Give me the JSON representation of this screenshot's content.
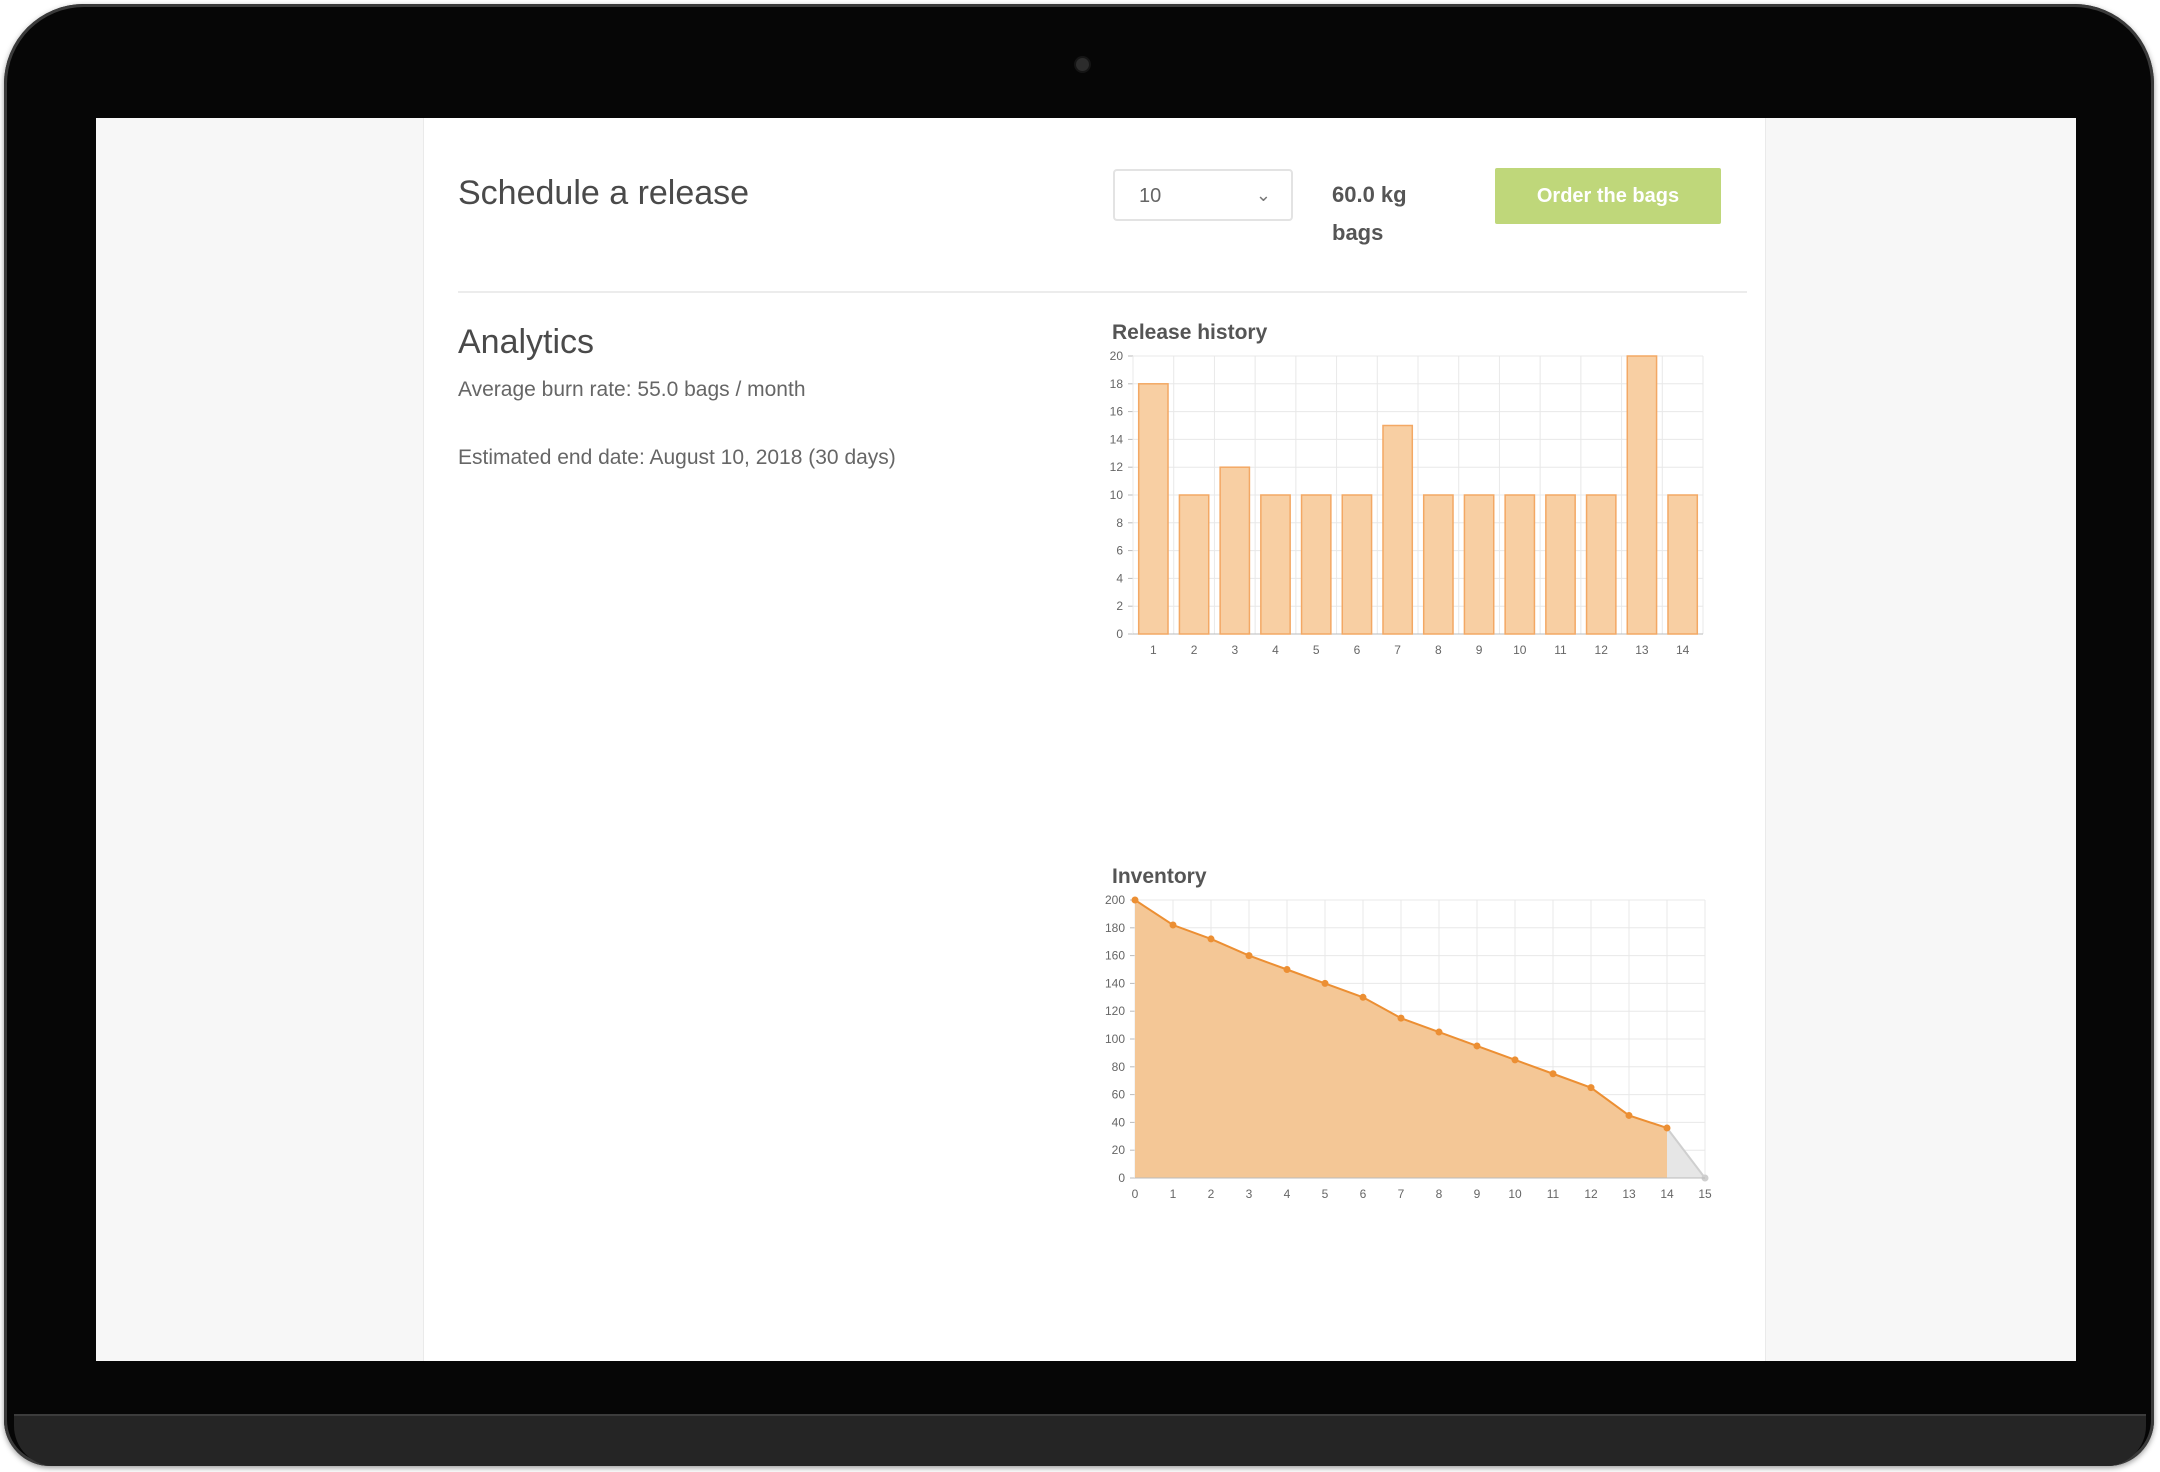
{
  "schedule": {
    "title": "Schedule a release",
    "quantity_value": "10",
    "unit_label": "60.0 kg bags",
    "order_button_label": "Order the bags"
  },
  "analytics": {
    "title": "Analytics",
    "burn_rate_text": "Average burn rate: 55.0 bags / month",
    "end_date_text": "Estimated end date: August 10, 2018 (30 days)"
  },
  "colors": {
    "accent_button": "#bfd77a",
    "bar_fill": "#f8cfa3",
    "bar_stroke": "#f3a864",
    "area_fill": "#f4c796",
    "line": "#ec8f33",
    "projection_fill": "#e6e6e6"
  },
  "chart_data": [
    {
      "type": "bar",
      "title": "Release history",
      "categories": [
        "1",
        "2",
        "3",
        "4",
        "5",
        "6",
        "7",
        "8",
        "9",
        "10",
        "11",
        "12",
        "13",
        "14"
      ],
      "values": [
        18,
        10,
        12,
        10,
        10,
        10,
        15,
        10,
        10,
        10,
        10,
        10,
        20,
        10
      ],
      "ylim": [
        0,
        20
      ],
      "yticks": [
        0,
        2,
        4,
        6,
        8,
        10,
        12,
        14,
        16,
        18,
        20
      ],
      "grid": true
    },
    {
      "type": "area",
      "title": "Inventory",
      "x": [
        0,
        1,
        2,
        3,
        4,
        5,
        6,
        7,
        8,
        9,
        10,
        11,
        12,
        13,
        14
      ],
      "values": [
        200,
        182,
        172,
        160,
        150,
        140,
        130,
        115,
        105,
        95,
        85,
        75,
        65,
        45,
        36
      ],
      "projection": {
        "x": [
          14,
          15
        ],
        "values": [
          36,
          0
        ]
      },
      "xticks": [
        "0",
        "1",
        "2",
        "3",
        "4",
        "5",
        "6",
        "7",
        "8",
        "9",
        "10",
        "11",
        "12",
        "13",
        "14",
        "15"
      ],
      "ylim": [
        0,
        200
      ],
      "yticks": [
        0,
        20,
        40,
        60,
        80,
        100,
        120,
        140,
        160,
        180,
        200
      ],
      "grid": true
    }
  ]
}
